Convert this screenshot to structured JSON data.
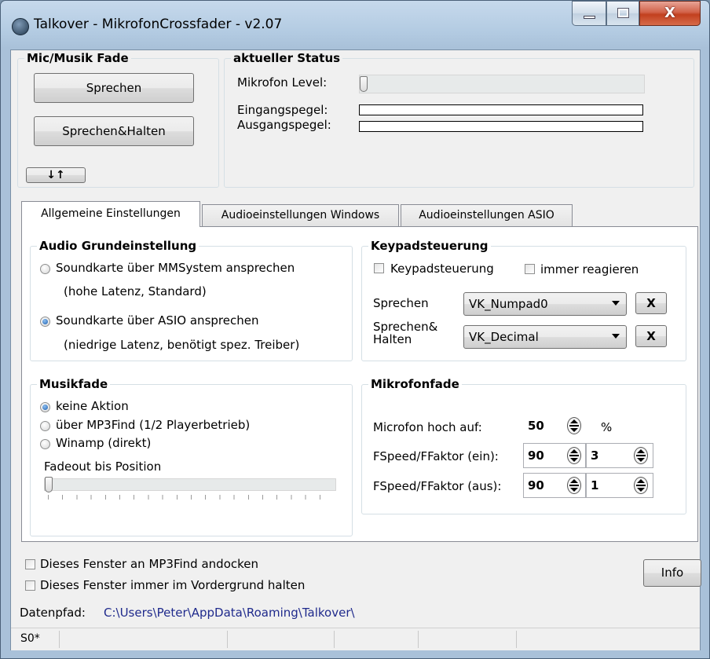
{
  "window": {
    "title": "Talkover - MikrofonCrossfader  - v2.07",
    "close_glyph": "X"
  },
  "mic_fade": {
    "title": "Mic/Musik Fade",
    "speak_button": "Sprechen",
    "speak_hold_button": "Sprechen&Halten",
    "toggle_button": "↓↑"
  },
  "status": {
    "title": "aktueller Status",
    "mic_level_label": "Mikrofon Level:",
    "input_level_label": "Eingangspegel:",
    "output_level_label": "Ausgangspegel:",
    "mic_level": 0
  },
  "tabs": [
    {
      "label": "Allgemeine Einstellungen",
      "active": true
    },
    {
      "label": "Audioeinstellungen Windows",
      "active": false
    },
    {
      "label": "Audioeinstellungen ASIO",
      "active": false
    }
  ],
  "audio_basic": {
    "title": "Audio Grundeinstellung",
    "option1": "Soundkarte über MMSystem ansprechen",
    "option1_note": "(hohe Latenz, Standard)",
    "option2": "Soundkarte über ASIO ansprechen",
    "option2_note": "(niedrige Latenz, benötigt spez. Treiber)",
    "selected": 2
  },
  "keypad": {
    "title": "Keypadsteuerung",
    "checkbox1": "Keypadsteuerung",
    "checkbox2": "immer reagieren",
    "speak_label": "Sprechen",
    "speak_value": "VK_Numpad0",
    "speak_hold_label_line1": "Sprechen&",
    "speak_hold_label_line2": "Halten",
    "speak_hold_value": "VK_Decimal",
    "clear_label": "X"
  },
  "music_fade": {
    "title": "Musikfade",
    "option1": "keine Aktion",
    "option2": "über MP3Find (1/2 Playerbetrieb)",
    "option3": "Winamp (direkt)",
    "selected": 1,
    "fadeout_label": "Fadeout bis Position",
    "fadeout_position": 0
  },
  "mic_fade_settings": {
    "title": "Mikrofonfade",
    "mic_up_label": "Microfon hoch auf:",
    "mic_up_value": "50",
    "mic_up_unit": "%",
    "fspeed_in_label": "FSpeed/FFaktor (ein):",
    "fspeed_in_speed": "90",
    "fspeed_in_factor": "3",
    "fspeed_out_label": "FSpeed/FFaktor (aus):",
    "fspeed_out_speed": "90",
    "fspeed_out_factor": "1"
  },
  "bottom": {
    "dock_checkbox": "Dieses Fenster an MP3Find andocken",
    "ontop_checkbox": "Dieses Fenster immer im Vordergrund halten",
    "info_button": "Info",
    "datapath_label": "Datenpfad:",
    "datapath_value": "C:\\Users\\Peter\\AppData\\Roaming\\Talkover\\"
  },
  "statusbar": {
    "cell1": "S0*"
  },
  "colors": {
    "title_bar": "#b3cbe2",
    "close_button": "#c2401f",
    "path_text": "#1f2a8c",
    "radio_checked": "#1c5fb0"
  }
}
